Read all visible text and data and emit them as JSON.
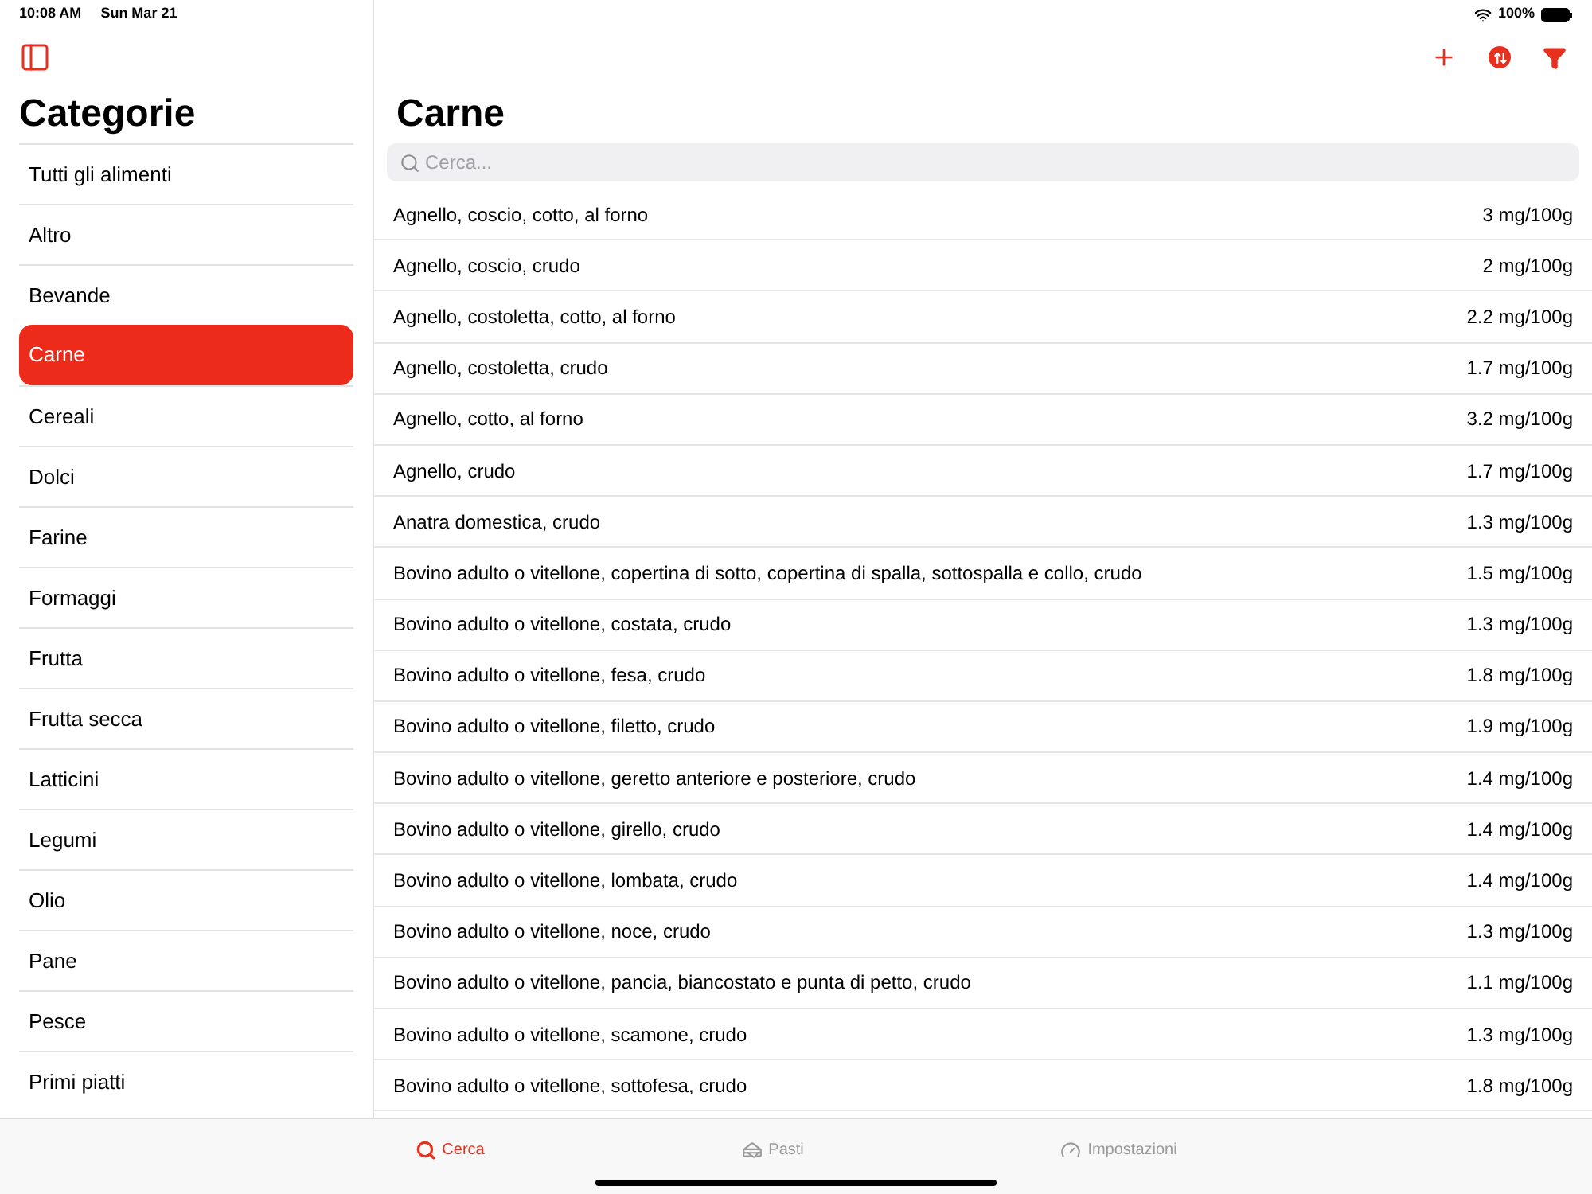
{
  "status_bar": {
    "time": "10:08 AM",
    "date": "Sun Mar 21",
    "battery": "100%"
  },
  "sidebar": {
    "title": "Categorie",
    "items": [
      {
        "label": "Tutti gli alimenti",
        "selected": false
      },
      {
        "label": "Altro",
        "selected": false
      },
      {
        "label": "Bevande",
        "selected": false
      },
      {
        "label": "Carne",
        "selected": true
      },
      {
        "label": "Cereali",
        "selected": false
      },
      {
        "label": "Dolci",
        "selected": false
      },
      {
        "label": "Farine",
        "selected": false
      },
      {
        "label": "Formaggi",
        "selected": false
      },
      {
        "label": "Frutta",
        "selected": false
      },
      {
        "label": "Frutta secca",
        "selected": false
      },
      {
        "label": "Latticini",
        "selected": false
      },
      {
        "label": "Legumi",
        "selected": false
      },
      {
        "label": "Olio",
        "selected": false
      },
      {
        "label": "Pane",
        "selected": false
      },
      {
        "label": "Pesce",
        "selected": false
      },
      {
        "label": "Primi piatti",
        "selected": false
      }
    ]
  },
  "main": {
    "title": "Carne",
    "search": {
      "placeholder": "Cerca..."
    },
    "rows": [
      {
        "name": "Agnello, coscio, cotto, al forno",
        "value": "3 mg/100g"
      },
      {
        "name": "Agnello, coscio, crudo",
        "value": "2 mg/100g"
      },
      {
        "name": "Agnello, costoletta, cotto, al forno",
        "value": "2.2 mg/100g"
      },
      {
        "name": "Agnello, costoletta, crudo",
        "value": "1.7 mg/100g"
      },
      {
        "name": "Agnello, cotto, al forno",
        "value": "3.2 mg/100g"
      },
      {
        "name": "Agnello, crudo",
        "value": "1.7 mg/100g"
      },
      {
        "name": "Anatra domestica, crudo",
        "value": "1.3 mg/100g"
      },
      {
        "name": "Bovino adulto o vitellone, copertina di sotto, copertina di spalla, sottospalla e collo, crudo",
        "value": "1.5 mg/100g"
      },
      {
        "name": "Bovino adulto o vitellone, costata, crudo",
        "value": "1.3 mg/100g"
      },
      {
        "name": "Bovino adulto o vitellone, fesa, crudo",
        "value": "1.8 mg/100g"
      },
      {
        "name": "Bovino adulto o vitellone, filetto, crudo",
        "value": "1.9 mg/100g"
      },
      {
        "name": "Bovino adulto o vitellone, geretto anteriore e posteriore, crudo",
        "value": "1.4 mg/100g"
      },
      {
        "name": "Bovino adulto o vitellone, girello, crudo",
        "value": "1.4 mg/100g"
      },
      {
        "name": "Bovino adulto o vitellone, lombata, crudo",
        "value": "1.4 mg/100g"
      },
      {
        "name": "Bovino adulto o vitellone, noce, crudo",
        "value": "1.3 mg/100g"
      },
      {
        "name": "Bovino adulto o vitellone, pancia, biancostato e punta di petto, crudo",
        "value": "1.1 mg/100g"
      },
      {
        "name": "Bovino adulto o vitellone, scamone, crudo",
        "value": "1.3 mg/100g"
      },
      {
        "name": "Bovino adulto o vitellone, sottofesa, crudo",
        "value": "1.8 mg/100g"
      }
    ]
  },
  "tab_bar": [
    {
      "label": "Cerca",
      "kind": "search",
      "selected": true
    },
    {
      "label": "Pasti",
      "kind": "meals",
      "selected": false
    },
    {
      "label": "Impostazioni",
      "kind": "settings",
      "selected": false
    }
  ]
}
